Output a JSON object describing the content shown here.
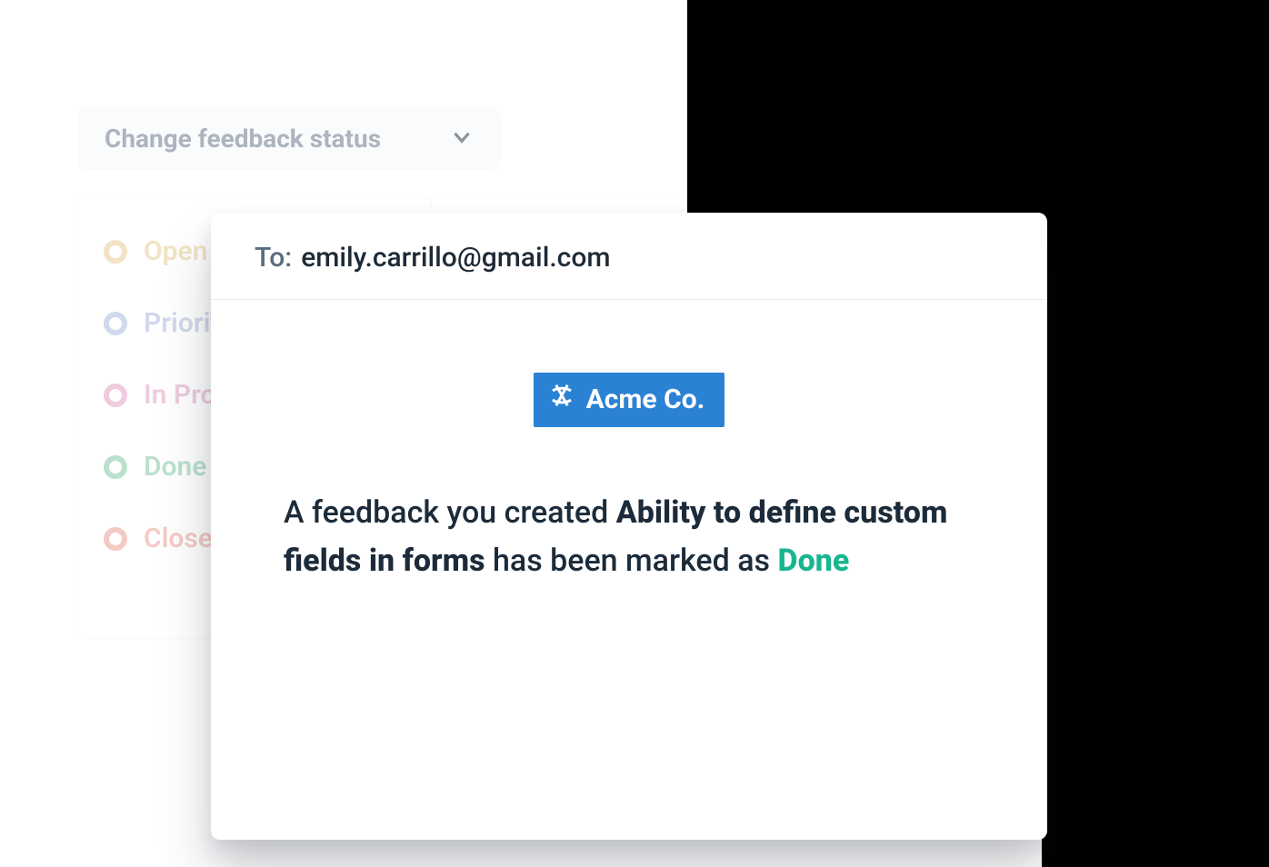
{
  "statusSelect": {
    "label": "Change feedback status"
  },
  "statusOptions": [
    {
      "label": "Open",
      "color": "#d8b15a"
    },
    {
      "label": "Priority",
      "color": "#7d94c9"
    },
    {
      "label": "In Progress",
      "color": "#cf6fa1"
    },
    {
      "label": "Done",
      "color": "#3fa874"
    },
    {
      "label": "Closed",
      "color": "#e06a5a"
    }
  ],
  "email": {
    "toLabel": "To:",
    "toValue": "emily.carrillo@gmail.com",
    "logoText": "Acme Co.",
    "message_before": "A feedback you created ",
    "feedback_title": "Ability to define custom fields in forms",
    "message_middle": " has been marked as ",
    "status_label": "Done",
    "status_color": "#17b690"
  }
}
